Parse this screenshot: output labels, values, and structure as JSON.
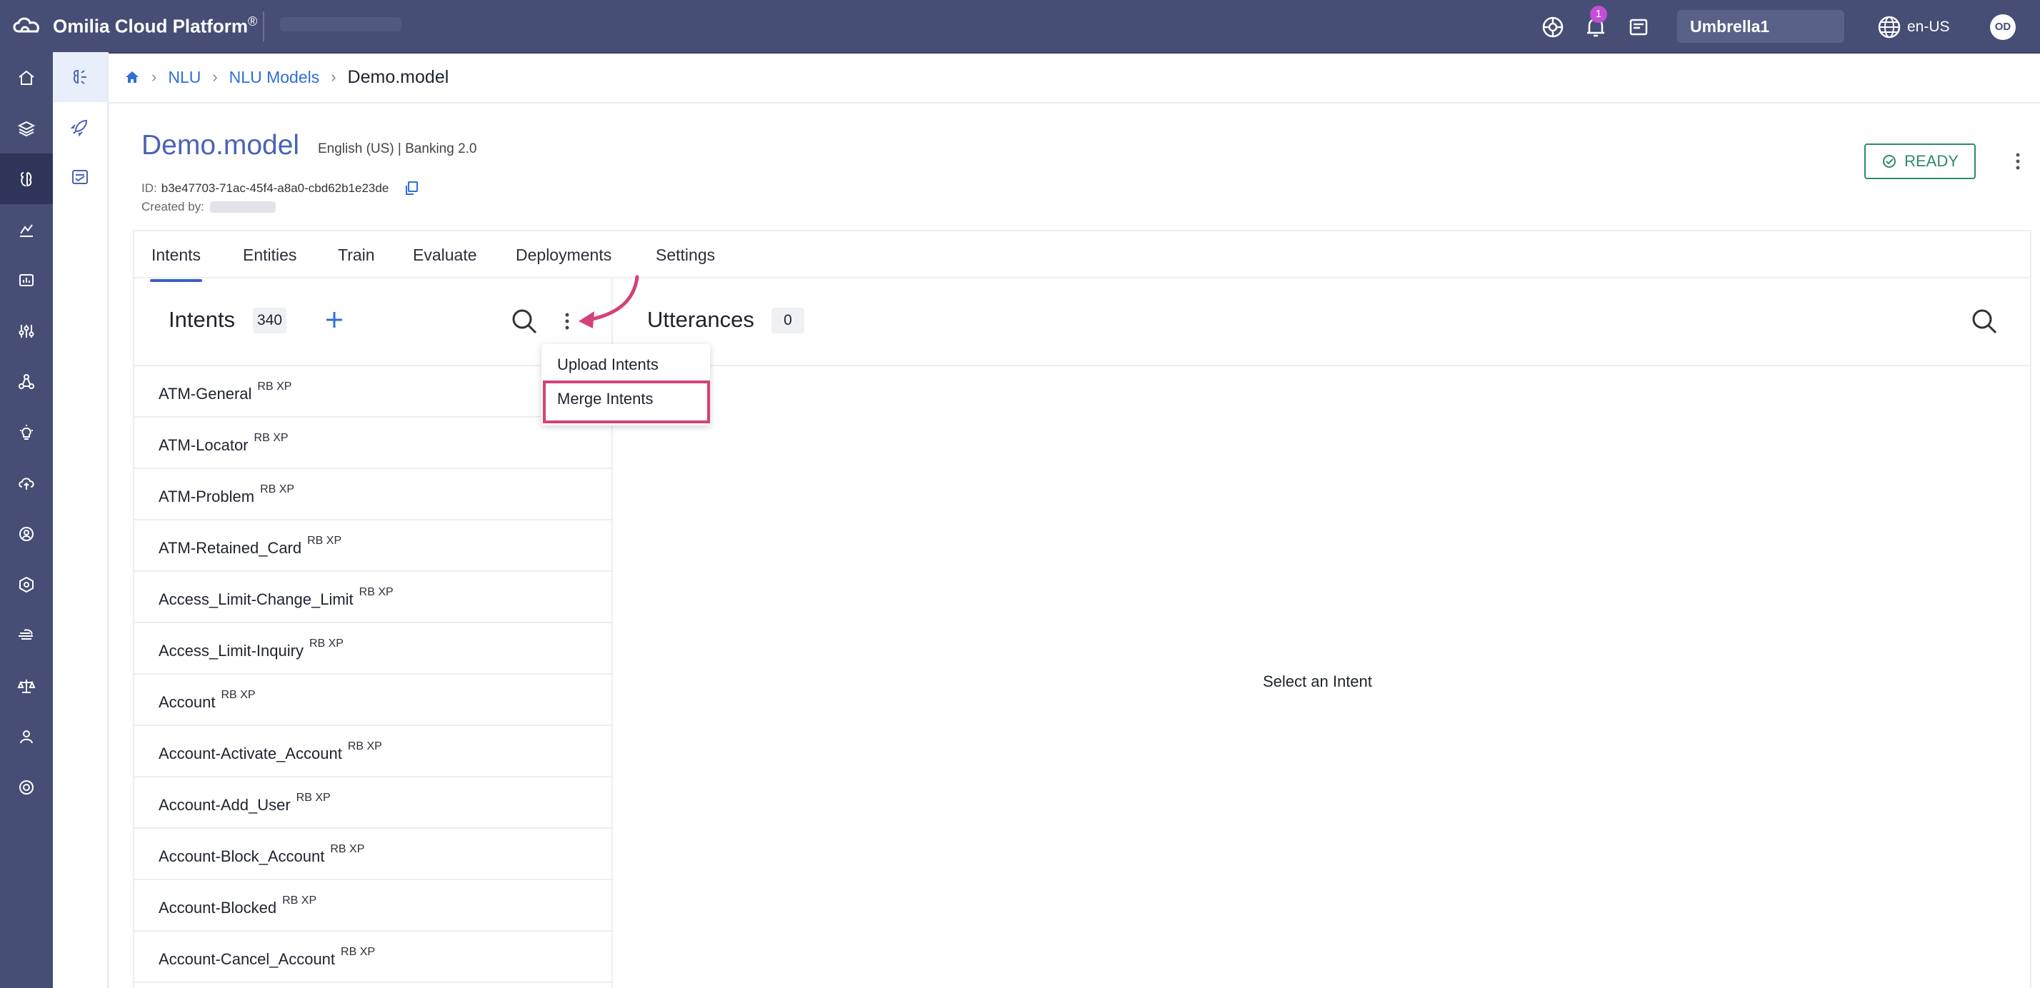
{
  "app": {
    "brand": "Omilia Cloud Platform",
    "brand_mark": "®",
    "notifications_count": "1",
    "tenant": "Umbrella1",
    "language": "en-US",
    "user_initials": "OD"
  },
  "leftnav": {
    "items": [
      {
        "icon": "home-icon"
      },
      {
        "icon": "layers-icon"
      },
      {
        "icon": "nlu-icon",
        "active": true
      },
      {
        "icon": "analytics-icon"
      },
      {
        "icon": "dashboard-icon"
      },
      {
        "icon": "sliders-icon"
      },
      {
        "icon": "network-icon"
      },
      {
        "icon": "lightbulb-icon"
      },
      {
        "icon": "cloud-upload-icon"
      },
      {
        "icon": "users-icon"
      },
      {
        "icon": "hexagon-icon"
      },
      {
        "icon": "speed-icon"
      },
      {
        "icon": "balance-icon"
      },
      {
        "icon": "user-icon"
      },
      {
        "icon": "support-icon"
      }
    ]
  },
  "subnav": {
    "items": [
      {
        "icon": "brain-icon",
        "active": true
      },
      {
        "icon": "rocket-icon"
      },
      {
        "icon": "checklist-icon"
      }
    ]
  },
  "breadcrumb": {
    "items": [
      "NLU",
      "NLU Models"
    ],
    "current": "Demo.model"
  },
  "model": {
    "title": "Demo.model",
    "meta": "English (US) | Banking 2.0",
    "id_label": "ID:",
    "id_value": "b3e47703-71ac-45f4-a8a0-cbd62b1e23de",
    "created_label": "Created by:",
    "status": "READY"
  },
  "tabs": [
    "Intents",
    "Entities",
    "Train",
    "Evaluate",
    "Deployments",
    "Settings"
  ],
  "intents": {
    "title": "Intents",
    "count": "340",
    "items": [
      {
        "name": "ATM-General",
        "tag": "RB XP"
      },
      {
        "name": "ATM-Locator",
        "tag": "RB XP"
      },
      {
        "name": "ATM-Problem",
        "tag": "RB XP"
      },
      {
        "name": "ATM-Retained_Card",
        "tag": "RB XP"
      },
      {
        "name": "Access_Limit-Change_Limit",
        "tag": "RB XP"
      },
      {
        "name": "Access_Limit-Inquiry",
        "tag": "RB XP"
      },
      {
        "name": "Account",
        "tag": "RB XP"
      },
      {
        "name": "Account-Activate_Account",
        "tag": "RB XP"
      },
      {
        "name": "Account-Add_User",
        "tag": "RB XP"
      },
      {
        "name": "Account-Block_Account",
        "tag": "RB XP"
      },
      {
        "name": "Account-Blocked",
        "tag": "RB XP"
      },
      {
        "name": "Account-Cancel_Account",
        "tag": "RB XP"
      }
    ]
  },
  "menu": {
    "items": [
      "Upload Intents",
      "Merge Intents"
    ]
  },
  "utterances": {
    "title": "Utterances",
    "count": "0",
    "empty": "Select an Intent"
  },
  "colors": {
    "topbar": "#474e75",
    "accent": "#3a5fc6",
    "ready": "#2e8b6a",
    "highlight": "#d3427a"
  }
}
